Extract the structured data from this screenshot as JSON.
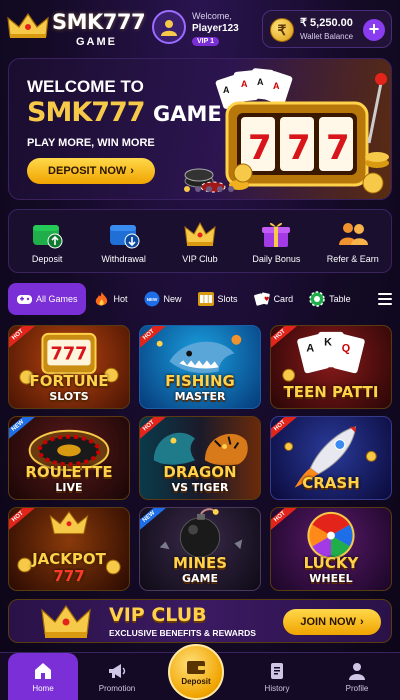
{
  "header": {
    "brand": "SMK777",
    "brand_sub": "GAME",
    "welcome": "Welcome,",
    "username": "Player123",
    "vip_level": "VIP 1",
    "wallet_symbol": "₹",
    "balance": "₹ 5,250.00",
    "wallet_label": "Wallet Balance",
    "add_label": "+"
  },
  "banner": {
    "line1": "WELCOME TO",
    "line2_brand": "SMK777",
    "line2_suffix": "GAME",
    "tagline": "PLAY MORE, WIN MORE",
    "cta": "DEPOSIT NOW",
    "slides": 5,
    "active_slide": 1
  },
  "quick_actions": [
    {
      "label": "Deposit",
      "icon": "wallet-up-icon"
    },
    {
      "label": "Withdrawal",
      "icon": "wallet-down-icon"
    },
    {
      "label": "VIP Club",
      "icon": "crown-icon"
    },
    {
      "label": "Daily Bonus",
      "icon": "gift-icon"
    },
    {
      "label": "Refer & Earn",
      "icon": "users-icon"
    }
  ],
  "categories": [
    {
      "label": "All Games",
      "icon": "gamepad-icon",
      "active": true
    },
    {
      "label": "Hot",
      "icon": "fire-icon"
    },
    {
      "label": "New",
      "icon": "new-badge-icon"
    },
    {
      "label": "Slots",
      "icon": "slot-icon"
    },
    {
      "label": "Card",
      "icon": "cards-icon"
    },
    {
      "label": "Table",
      "icon": "chips-icon"
    }
  ],
  "games": [
    {
      "l1": "FORTUNE",
      "l2": "SLOTS",
      "tag": "HOT"
    },
    {
      "l1": "FISHING",
      "l2": "MASTER",
      "tag": "HOT"
    },
    {
      "l1": "TEEN PATTI",
      "l2": "",
      "tag": "HOT"
    },
    {
      "l1": "ROULETTE",
      "l2": "LIVE",
      "tag": "NEW"
    },
    {
      "l1": "DRAGON",
      "l2": "VS TIGER",
      "tag": "HOT"
    },
    {
      "l1": "CRASH",
      "l2": "",
      "tag": "HOT"
    },
    {
      "l1": "JACKPOT",
      "l2": "777",
      "tag": "HOT"
    },
    {
      "l1": "MINES",
      "l2": "GAME",
      "tag": "NEW"
    },
    {
      "l1": "LUCKY",
      "l2": "WHEEL",
      "tag": "HOT"
    }
  ],
  "vip_club": {
    "title": "VIP CLUB",
    "desc": "EXCLUSIVE BENEFITS & REWARDS",
    "cta": "JOIN NOW"
  },
  "nav": {
    "home": "Home",
    "promotion": "Promotion",
    "deposit": "Deposit",
    "history": "History",
    "profile": "Profile"
  },
  "colors": {
    "accent": "#7b2fd6",
    "gold": "#f7c948",
    "bg": "#140a26"
  }
}
